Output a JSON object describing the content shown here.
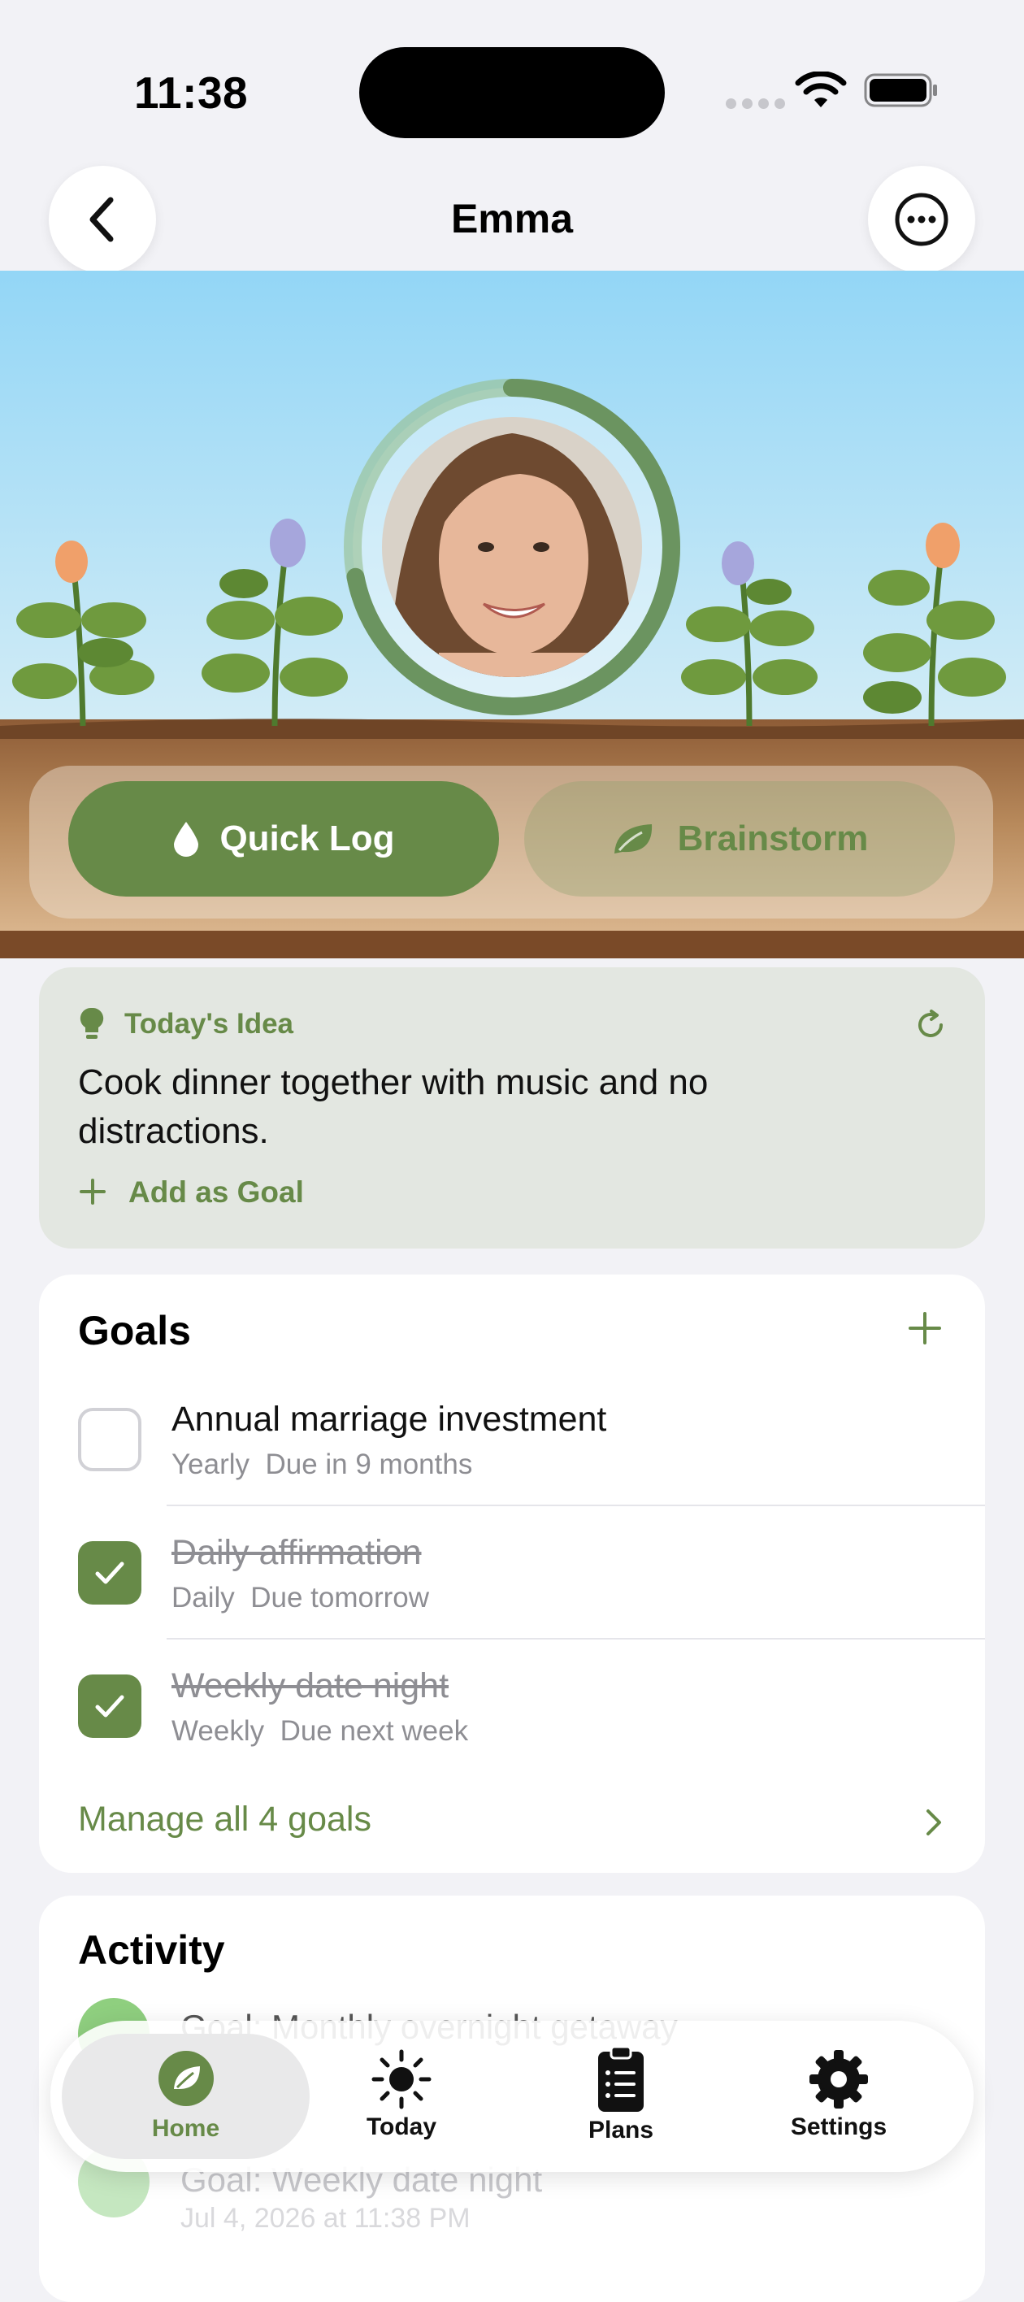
{
  "status": {
    "time": "11:38"
  },
  "nav": {
    "title": "Emma",
    "back_icon": "chevron-left-icon",
    "more_icon": "ellipsis-circle-icon"
  },
  "hero": {
    "progress_fraction": 0.72
  },
  "actions": {
    "quick_log": "Quick Log",
    "brainstorm": "Brainstorm"
  },
  "idea": {
    "label": "Today's Idea",
    "text": "Cook dinner together with music and no distractions.",
    "add_label": "Add as Goal"
  },
  "goals": {
    "heading": "Goals",
    "items": [
      {
        "title": "Annual marriage investment",
        "frequency": "Yearly",
        "due": "Due in 9 months",
        "done": false
      },
      {
        "title": "Daily affirmation",
        "frequency": "Daily",
        "due": "Due tomorrow",
        "done": true
      },
      {
        "title": "Weekly date night",
        "frequency": "Weekly",
        "due": "Due next week",
        "done": true
      }
    ],
    "manage_label": "Manage all 4 goals"
  },
  "activity": {
    "heading": "Activity",
    "rows": [
      {
        "title": "Goal: Monthly overnight getaway",
        "time": ""
      },
      {
        "title": "Goal: Weekly date night",
        "time": "Jul 4, 2026 at 11:38 PM"
      }
    ]
  },
  "tabs": [
    {
      "label": "Home",
      "icon": "leaf-icon",
      "selected": true
    },
    {
      "label": "Today",
      "icon": "sun-icon",
      "selected": false
    },
    {
      "label": "Plans",
      "icon": "clipboard-list-icon",
      "selected": false
    },
    {
      "label": "Settings",
      "icon": "gear-icon",
      "selected": false
    }
  ],
  "colors": {
    "accent": "#678a48",
    "sky": "#9fd8f3",
    "soil": "#8b5a34"
  }
}
